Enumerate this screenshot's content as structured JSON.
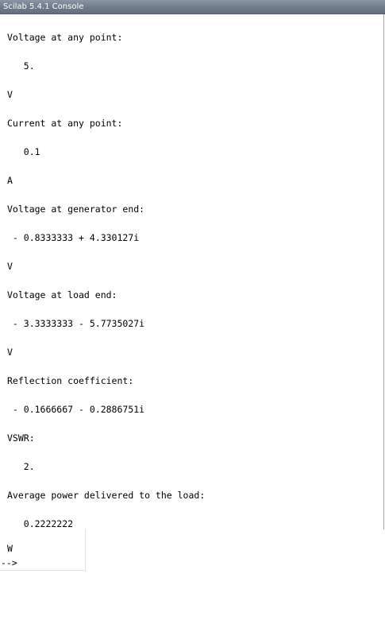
{
  "window": {
    "title": "Scilab 5.4.1 Console"
  },
  "console": {
    "lines": [
      "Voltage at any point:",
      "   5.",
      "V",
      "Current at any point:",
      "   0.1",
      "A",
      "Voltage at generator end:",
      " - 0.8333333 + 4.330127i",
      "V",
      "Voltage at load end:",
      " - 3.3333333 - 5.7735027i",
      "V",
      "Reflection coefficient:",
      " - 0.1666667 - 0.2886751i",
      "VSWR:",
      "   2.",
      "Average power delivered to the load:",
      "   0.2222222"
    ],
    "last_unit": "W",
    "prompt": "-->"
  }
}
